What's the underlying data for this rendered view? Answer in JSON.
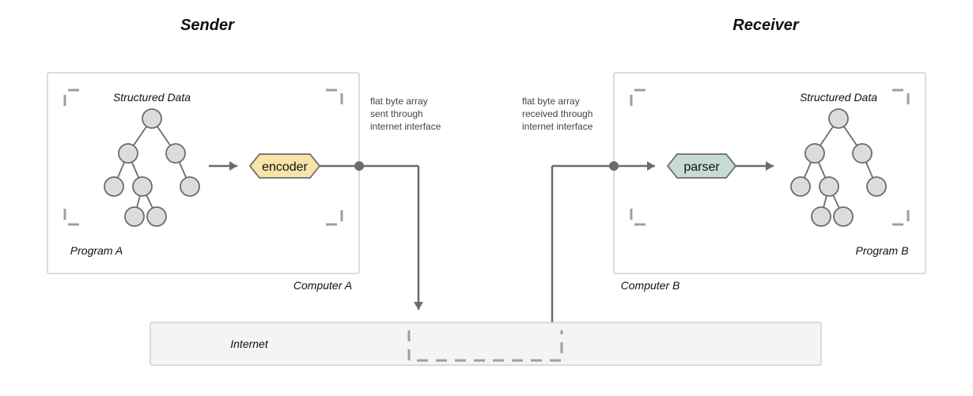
{
  "titles": {
    "sender": "Sender",
    "receiver": "Receiver"
  },
  "labels": {
    "structured_data_a": "Structured Data",
    "structured_data_b": "Structured Data",
    "program_a": "Program A",
    "program_b": "Program B",
    "computer_a": "Computer A",
    "computer_b": "Computer B",
    "internet": "Internet",
    "encoder": "encoder",
    "parser": "parser"
  },
  "annotations": {
    "sent_line1": "flat byte array",
    "sent_line2": "sent through",
    "sent_line3": "internet interface",
    "recv_line1": "flat byte array",
    "recv_line2": "received through",
    "recv_line3": "internet interface"
  },
  "colors": {
    "encoder_fill": "#f6e4a9",
    "parser_fill": "#c6dad6",
    "node_fill": "#dcdcdc",
    "stroke": "#6b6b6b",
    "box_stroke": "#d0d0d0",
    "internet_fill": "#f4f4f4"
  }
}
